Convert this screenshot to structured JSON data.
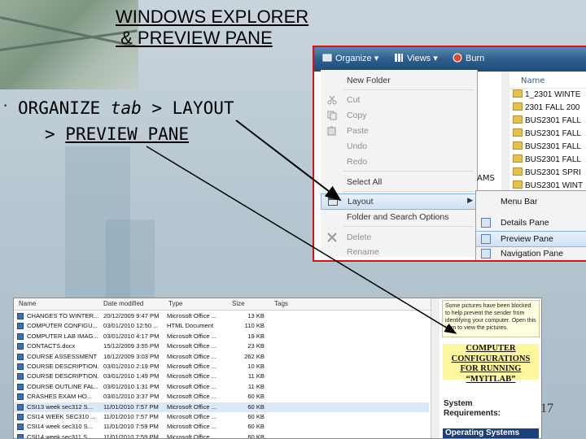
{
  "slide": {
    "title_line1": "WINDOWS EXPLORER",
    "title_line2": " & PREVIEW PANE",
    "bullet": "•",
    "step_line1_a": "ORGANIZE ",
    "step_line1_b": "tab",
    "step_line1_c": " > LAYOUT",
    "step_line2_a": "> ",
    "step_line2_b": "PREVIEW PANE",
    "page_number": "17"
  },
  "organize_window": {
    "toolbar": {
      "organize": "Organize ▾",
      "views": "Views ▾",
      "burn": "Burn"
    },
    "menu": [
      {
        "label": "New Folder",
        "disabled": false,
        "icon": ""
      },
      {
        "label": "Cut",
        "disabled": true,
        "icon": "scissors-icon"
      },
      {
        "label": "Copy",
        "disabled": true,
        "icon": "copy-icon"
      },
      {
        "label": "Paste",
        "disabled": true,
        "icon": "paste-icon"
      },
      {
        "label": "Undo",
        "disabled": true,
        "icon": ""
      },
      {
        "label": "Redo",
        "disabled": true,
        "icon": ""
      },
      {
        "label": "Select All",
        "disabled": false,
        "icon": ""
      },
      {
        "label": "Layout",
        "disabled": false,
        "icon": "layout-icon",
        "highlighted": true
      },
      {
        "label": "Folder and Search Options",
        "disabled": false,
        "icon": ""
      },
      {
        "label": "Delete",
        "disabled": true,
        "icon": "delete-icon"
      },
      {
        "label": "Rename",
        "disabled": true,
        "icon": ""
      }
    ],
    "submenu": [
      {
        "label": "Menu Bar"
      },
      {
        "label": "Details Pane"
      },
      {
        "label": "Preview Pane",
        "highlighted": true
      },
      {
        "label": "Navigation Pane"
      }
    ],
    "file_list_header": "Name",
    "ams_text": "AMS",
    "folders": [
      "1_2301 WINTE",
      "2301 FALL 200",
      "BUS2301 FALL",
      "BUS2301 FALL",
      "BUS2301 FALL",
      "BUS2301 FALL",
      "BUS2301 SPRI",
      "BUS2301 WINT"
    ]
  },
  "explorer_window": {
    "headers": {
      "name": "Name",
      "date": "Date modified",
      "type": "Type",
      "size": "Size",
      "tags": "Tags"
    },
    "rows": [
      {
        "name": "CHANGES TO WINTER...",
        "date": "20/12/2009 9:47 PM",
        "type": "Microsoft Office ...",
        "size": "13 KB"
      },
      {
        "name": "COMPUTER CONFIGU...",
        "date": "03/01/2010 12:50 ...",
        "type": "HTML Document",
        "size": "110 KB"
      },
      {
        "name": "COMPUTER LAB IMAG...",
        "date": "03/01/2010 4:17 PM",
        "type": "Microsoft Office ...",
        "size": "19 KB"
      },
      {
        "name": "CONTACTS.docx",
        "date": "15/12/2009 3:55 PM",
        "type": "Microsoft Office ...",
        "size": "23 KB"
      },
      {
        "name": "COURSE ASSESSMENT ...",
        "date": "16/12/2009 3:03 PM",
        "type": "Microsoft Office ...",
        "size": "262 KB"
      },
      {
        "name": "COURSE DESCRIPTION...",
        "date": "03/01/2010 2:19 PM",
        "type": "Microsoft Office ...",
        "size": "10 KB"
      },
      {
        "name": "COURSE DESCRIPTION...",
        "date": "03/01/2010 1:49 PM",
        "type": "Microsoft Office ...",
        "size": "11 KB"
      },
      {
        "name": "COURSE OUTLINE FAL...",
        "date": "03/01/2010 1:31 PM",
        "type": "Microsoft Office ...",
        "size": "11 KB"
      },
      {
        "name": "CRASHES EXAM HO...",
        "date": "03/01/2010 3:37 PM",
        "type": "Microsoft Office ...",
        "size": "60 KB"
      },
      {
        "name": "CSI13 week sec312 S...",
        "date": "11/01/2010 7:57 PM",
        "type": "Microsoft Office ...",
        "size": "60 KB"
      },
      {
        "name": "CSI14 WEEK SEC310 ...",
        "date": "11/01/2010 7:57 PM",
        "type": "Microsoft Office ...",
        "size": "60 KB"
      },
      {
        "name": "CSI14 week sec310 S...",
        "date": "11/01/2010 7:59 PM",
        "type": "Microsoft Office ...",
        "size": "60 KB"
      },
      {
        "name": "CSI14 week sec311 S...",
        "date": "11/01/2010 7:59 PM",
        "type": "Microsoft Office ...",
        "size": "60 KB"
      }
    ],
    "preview": {
      "blocked_note": "Some pictures have been blocked to help prevent the sender from identifying your computer. Open this item to view the pictures.",
      "heading_line1": "COMPUTER",
      "heading_line2": "CONFIGURATIONS",
      "heading_line3": "FOR RUNNING",
      "heading_line4": "“MYITLAB”",
      "req_line1": "System",
      "req_line2": "Requirements:",
      "os_label": "Operating Systems"
    }
  }
}
